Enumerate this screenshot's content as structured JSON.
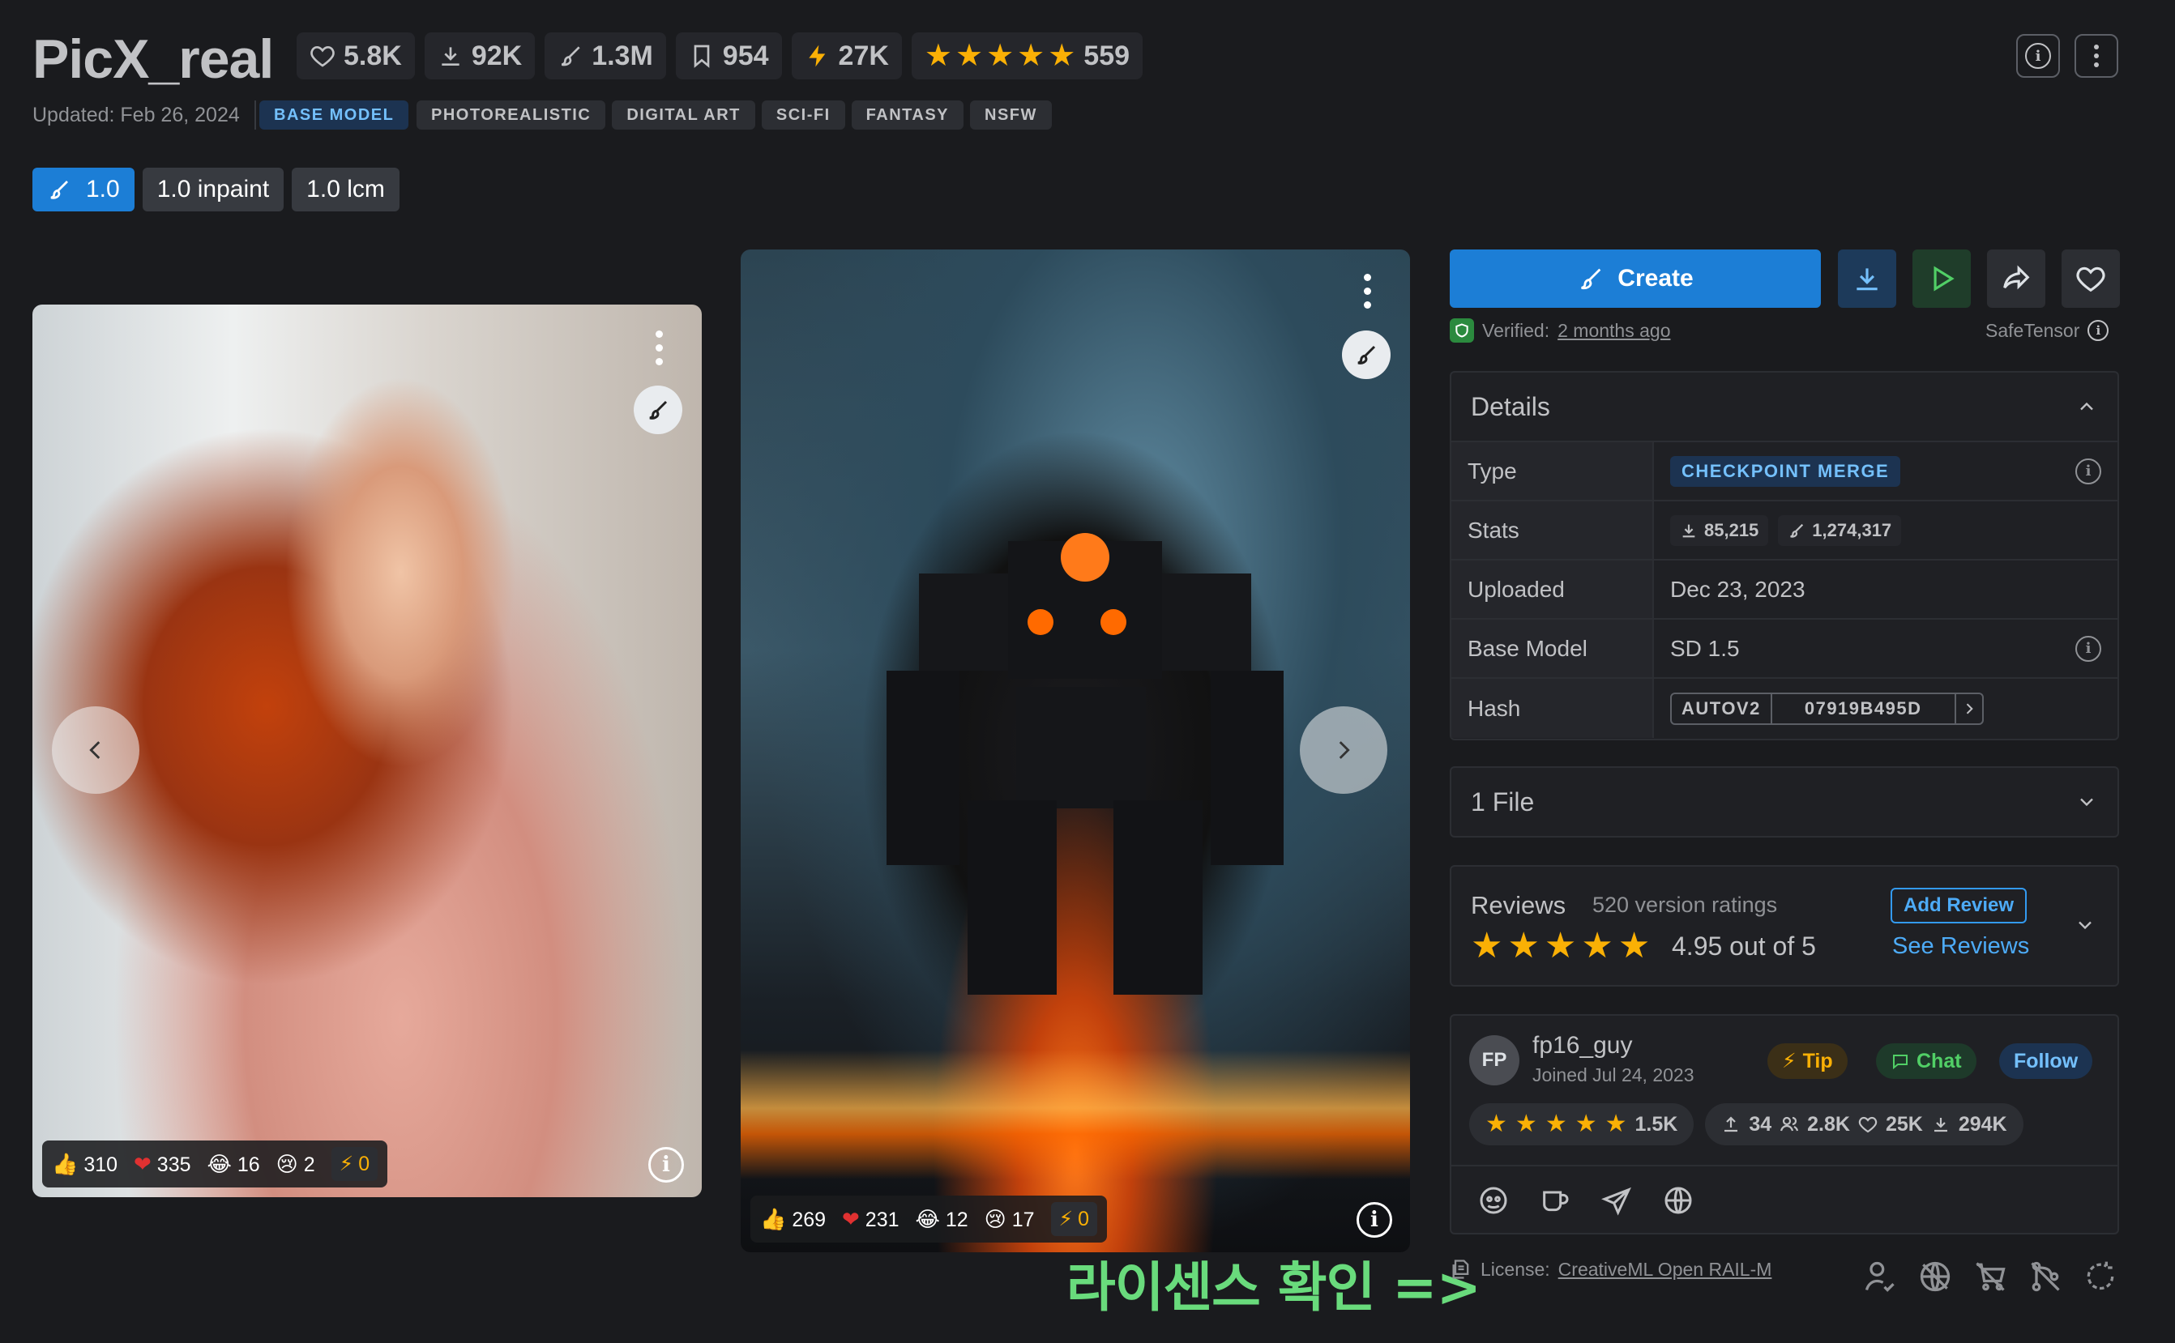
{
  "header": {
    "title": "PicX_real",
    "stats": {
      "likes": "5.8K",
      "downloads": "92K",
      "generations": "1.3M",
      "bookmarks": "954",
      "buzz": "27K",
      "rating_count": "559"
    },
    "updated": "Updated: Feb 26, 2024",
    "base_tag": "BASE MODEL",
    "tags": [
      "PHOTOREALISTIC",
      "DIGITAL ART",
      "SCI-FI",
      "FANTASY",
      "NSFW"
    ],
    "versions": [
      "1.0",
      "1.0 inpaint",
      "1.0 lcm"
    ]
  },
  "gallery": {
    "image1": {
      "thumbs": "310",
      "hearts": "335",
      "laughs": "16",
      "cries": "2",
      "buzz": "0"
    },
    "image2": {
      "thumbs": "269",
      "hearts": "231",
      "laughs": "12",
      "cries": "17",
      "buzz": "0"
    }
  },
  "actions": {
    "create_label": "Create",
    "verified_label": "Verified:",
    "verified_time": "2 months ago",
    "safetensor_label": "SafeTensor"
  },
  "details": {
    "heading": "Details",
    "rows": {
      "type_label": "Type",
      "type_value": "CHECKPOINT MERGE",
      "stats_label": "Stats",
      "stats_downloads": "85,215",
      "stats_generations": "1,274,317",
      "uploaded_label": "Uploaded",
      "uploaded_value": "Dec 23, 2023",
      "base_model_label": "Base Model",
      "base_model_value": "SD 1.5",
      "hash_label": "Hash",
      "hash_type": "AUTOV2",
      "hash_value": "07919B495D"
    }
  },
  "files": {
    "label": "1 File"
  },
  "reviews": {
    "title": "Reviews",
    "count_text": "520 version ratings",
    "score_text": "4.95 out of 5",
    "add_review": "Add Review",
    "see_reviews": "See Reviews"
  },
  "creator": {
    "initials": "FP",
    "name": "fp16_guy",
    "joined": "Joined Jul 24, 2023",
    "tip": "Tip",
    "chat": "Chat",
    "follow": "Follow",
    "rating_count": "1.5K",
    "uploads": "34",
    "followers": "2.8K",
    "likes": "25K",
    "downloads": "294K"
  },
  "license": {
    "label": "License:",
    "name": "CreativeML Open RAIL-M"
  },
  "overlay_note": "라이센스 확인 =>",
  "colors": {
    "background": "#1a1b1e",
    "accent_blue": "#1c7ed6",
    "star_yellow": "#fab005",
    "note_green": "#69db7c"
  }
}
